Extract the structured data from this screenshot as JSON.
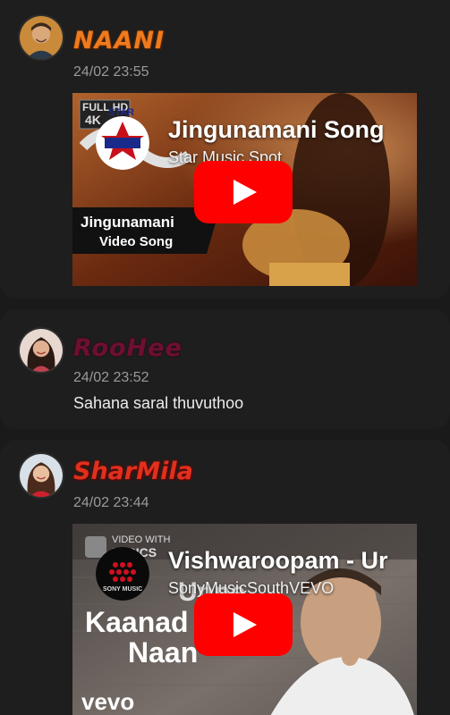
{
  "posts": [
    {
      "username": "NAANI",
      "timestamp": "24/02 23:55",
      "video": {
        "title": "Jingunamani Song",
        "channel": "Star Music Spot",
        "thumb_text": [
          "FULL HD",
          "4K",
          "STAR",
          "Jingunamani",
          "Video Song"
        ]
      }
    },
    {
      "username": "RooHee",
      "timestamp": "24/02 23:52",
      "message": "Sahana saral thuvuthoo"
    },
    {
      "username": "SharMila",
      "timestamp": "24/02 23:44",
      "video": {
        "title": "Vishwaroopam - Ur",
        "channel": "SonyMusicSouthVEVO",
        "thumb_text": [
          "VIDEO WITH",
          "LYRICS",
          "SONY MUSIC",
          "Unne",
          "Kaanad",
          "Naan",
          "vevo"
        ]
      }
    }
  ],
  "colors": {
    "background": "#1a1a1a",
    "card": "#1e1e1e",
    "naani": "#f07a1c",
    "roohee": "#6e0f32",
    "sharmila": "#e0301e",
    "play_button": "#ff0000",
    "timestamp": "#9a9a9a"
  },
  "icons": [
    "play-icon",
    "user-avatar",
    "channel-logo"
  ]
}
